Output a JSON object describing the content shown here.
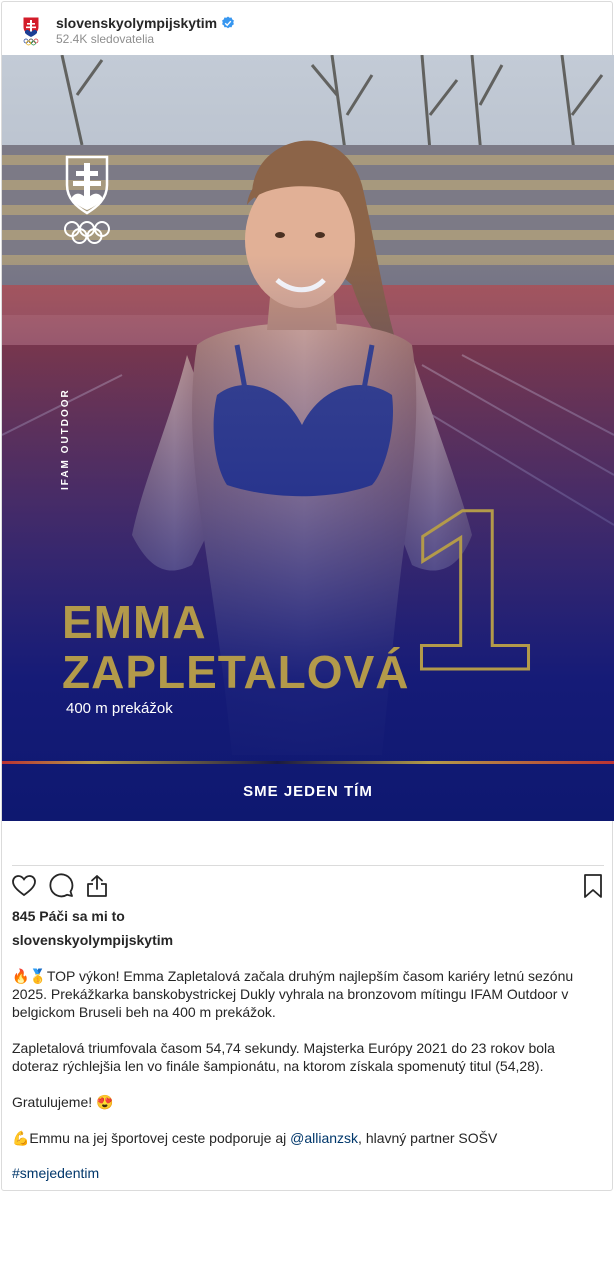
{
  "header": {
    "username": "slovenskyolympijskytim",
    "followers": "52.4K sledovatelia"
  },
  "media": {
    "side_text": "IFAM OUTDOOR",
    "first_name": "EMMA",
    "last_name": "ZAPLETALOVÁ",
    "event": "400 m prekážok",
    "place": "1",
    "slogan": "SME JEDEN TÍM"
  },
  "post": {
    "likes": "845 Páči sa mi to",
    "caption_user": "slovenskyolympijskytim",
    "line1": "🔥🥇TOP výkon! Emma Zapletalová začala druhým najlepším časom kariéry letnú sezónu 2025. Prekážkarka banskobystrickej Dukly vyhrala na bronzovom mítingu IFAM Outdoor v belgickom Bruseli beh na 400 m prekážok.",
    "line2": "Zapletalová triumfovala časom 54,74 sekundy. Majsterka Európy 2021 do 23 rokov bola doteraz rýchlejšia len vo finále šampionátu, na ktorom získala spomenutý titul (54,28).",
    "line3": "Gratulujeme! 😍",
    "line4_prefix": "💪Emmu na jej športovej ceste podporuje aj ",
    "mention": "@allianzsk",
    "line4_suffix": ", hlavný partner SOŠV",
    "hashtag": "#smejedentim"
  },
  "colors": {
    "gold": "#b39a4a",
    "navy": "#152a8a",
    "link": "#00376b"
  }
}
